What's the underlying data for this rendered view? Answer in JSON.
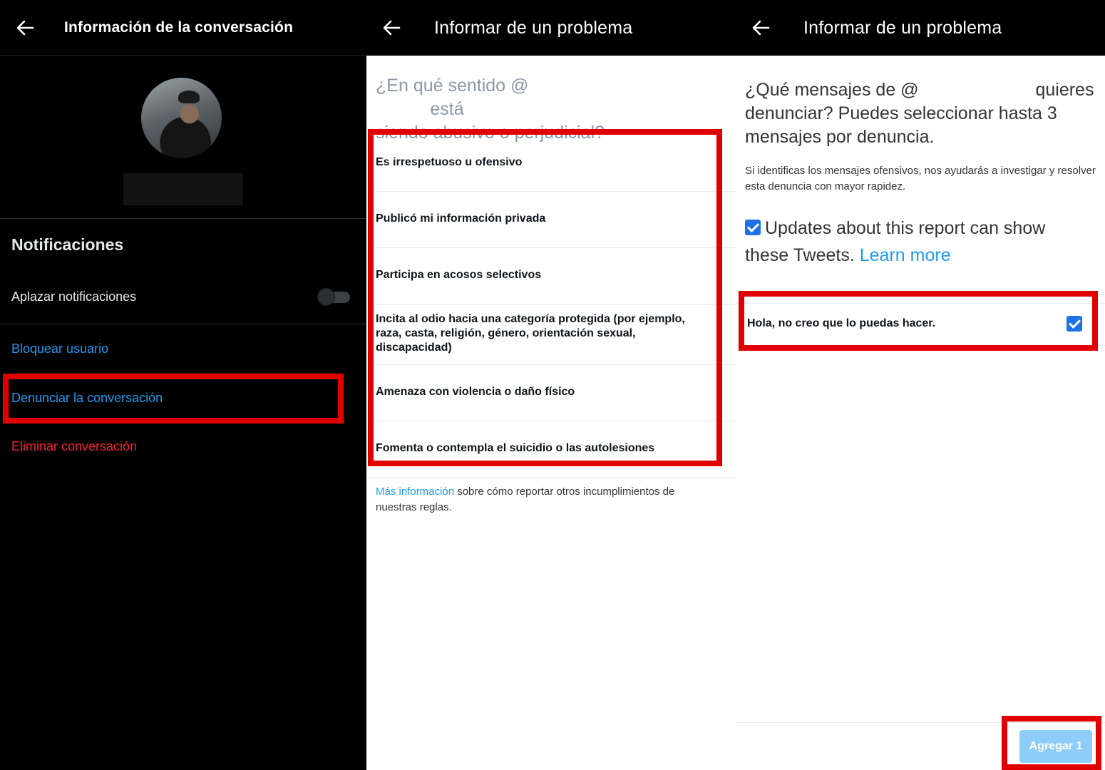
{
  "panel1": {
    "title": "Información de la conversación",
    "notifications_heading": "Notificaciones",
    "snooze_label": "Aplazar notificaciones",
    "snooze_enabled": false,
    "block_label": "Bloquear usuario",
    "report_label": "Denunciar la conversación",
    "delete_label": "Eliminar conversación"
  },
  "panel2": {
    "title": "Informar de un problema",
    "question_part1": "¿En qué sentido @",
    "question_part2": "está",
    "question_part3": "siendo abusivo o perjudicial?",
    "options": [
      "Es irrespetuoso u ofensivo",
      "Publicó mi información privada",
      "Participa en acosos selectivos",
      "Incita al odio hacia una categoría protegida (por ejemplo, raza, casta, religión, género, orientación sexual, discapacidad)",
      "Amenaza con violencia o daño físico",
      "Fomenta o contempla el suicidio o las autolesiones"
    ],
    "more_info_link": "Más información",
    "more_info_rest": " sobre cómo reportar otros incumplimientos de nuestras reglas."
  },
  "panel3": {
    "title": "Informar de un problema",
    "question_part1": "¿Qué mensajes de @",
    "question_part2": "quieres",
    "question_part3": "denunciar? Puedes seleccionar hasta 3 mensajes por denuncia.",
    "description": "Si identificas los mensajes ofensivos, nos ayudarás a investigar y resolver esta denuncia con mayor rapidez.",
    "updates_text": "Updates about this report can show these Tweets. ",
    "learn_more": "Learn more",
    "updates_checked": true,
    "message_text": "Hola, no creo que lo puedas hacer.",
    "message_checked": true,
    "add_button": "Agregar 1"
  },
  "colors": {
    "accent_blue": "#1d9bf0",
    "danger_red": "#f4212e",
    "highlight_red": "#e00000"
  }
}
